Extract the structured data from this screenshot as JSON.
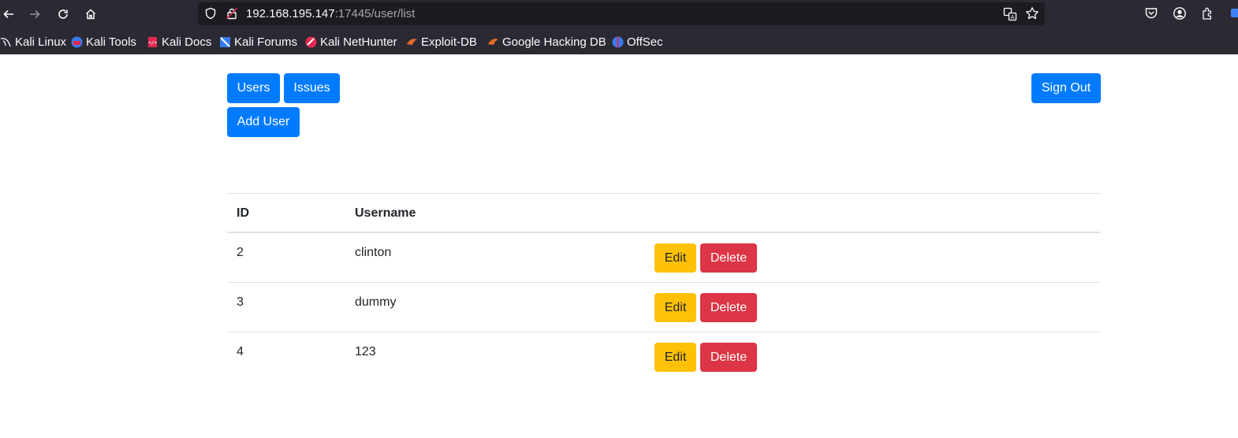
{
  "browser": {
    "url_host": "192.168.195.147",
    "url_path": ":17445/user/list",
    "icons": [
      "back-icon",
      "forward-icon",
      "reload-icon",
      "home-icon",
      "shield-icon",
      "lock-icon",
      "translate-icon",
      "star-icon",
      "pocket-icon",
      "account-icon",
      "extensions-icon"
    ],
    "bookmarks": [
      {
        "label": "Kali Linux",
        "icon": "kali-dragon-icon"
      },
      {
        "label": "Kali Tools",
        "icon": "kali-tools-icon"
      },
      {
        "label": "Kali Docs",
        "icon": "kali-docs-icon"
      },
      {
        "label": "Kali Forums",
        "icon": "kali-forums-icon"
      },
      {
        "label": "Kali NetHunter",
        "icon": "kali-nethunter-icon"
      },
      {
        "label": "Exploit-DB",
        "icon": "exploit-db-icon"
      },
      {
        "label": "Google Hacking DB",
        "icon": "ghdb-icon"
      },
      {
        "label": "OffSec",
        "icon": "offsec-icon"
      }
    ]
  },
  "nav": {
    "users_label": "Users",
    "issues_label": "Issues",
    "add_user_label": "Add User",
    "sign_out_label": "Sign Out"
  },
  "table": {
    "headers": [
      "ID",
      "Username"
    ],
    "rows": [
      {
        "id": "2",
        "username": "clinton",
        "edit": "Edit",
        "delete": "Delete"
      },
      {
        "id": "3",
        "username": "dummy",
        "edit": "Edit",
        "delete": "Delete"
      },
      {
        "id": "4",
        "username": "123",
        "edit": "Edit",
        "delete": "Delete"
      }
    ]
  },
  "colors": {
    "primary": "#007bff",
    "warning": "#ffc107",
    "danger": "#dc3545",
    "chrome_bg": "#2b2a33"
  }
}
